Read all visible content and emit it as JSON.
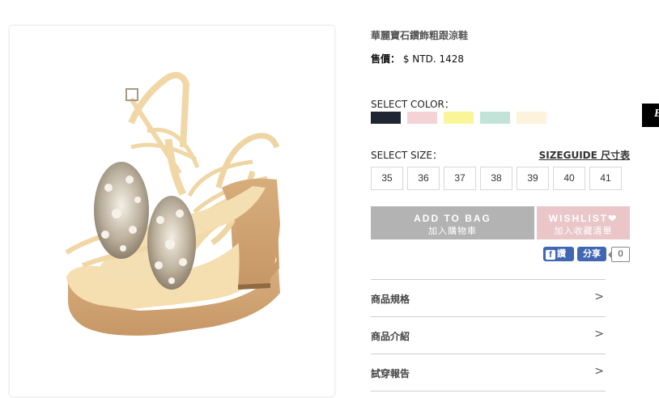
{
  "product": {
    "title": "華麗寶石鑽飾粗跟涼鞋",
    "price_label": "售價：",
    "price_value": "$ NTD. 1428"
  },
  "color_section": {
    "label": "SELECT COLOR：",
    "swatches": [
      {
        "name": "navy",
        "hex": "#1f2533"
      },
      {
        "name": "pink",
        "hex": "#f3d3d6"
      },
      {
        "name": "yellow",
        "hex": "#fbf59a"
      },
      {
        "name": "mint",
        "hex": "#c2e3d8"
      },
      {
        "name": "cream",
        "hex": "#fdf3dc"
      }
    ]
  },
  "size_section": {
    "label": "SELECT SIZE：",
    "guide_link": "SIZEGUIDE 尺寸表",
    "sizes": [
      "35",
      "36",
      "37",
      "38",
      "39",
      "40",
      "41"
    ]
  },
  "actions": {
    "add_to_bag": "ADD TO BAG",
    "add_to_bag_sub": "加入購物車",
    "wishlist": "WISHLIST❤",
    "wishlist_sub": "加入收藏清單"
  },
  "social": {
    "like_label": "讚",
    "share_label": "分享",
    "share_count": "0"
  },
  "accordion": [
    {
      "label": "商品規格",
      "arrow": ">"
    },
    {
      "label": "商品介紹",
      "arrow": ">"
    },
    {
      "label": "試穿報告",
      "arrow": ">"
    }
  ],
  "colors": {
    "add_btn": "#b3b3b3",
    "wishlist_btn": "#eac6c9",
    "facebook": "#4267b2"
  },
  "side_tab": {
    "glyph": "E"
  }
}
